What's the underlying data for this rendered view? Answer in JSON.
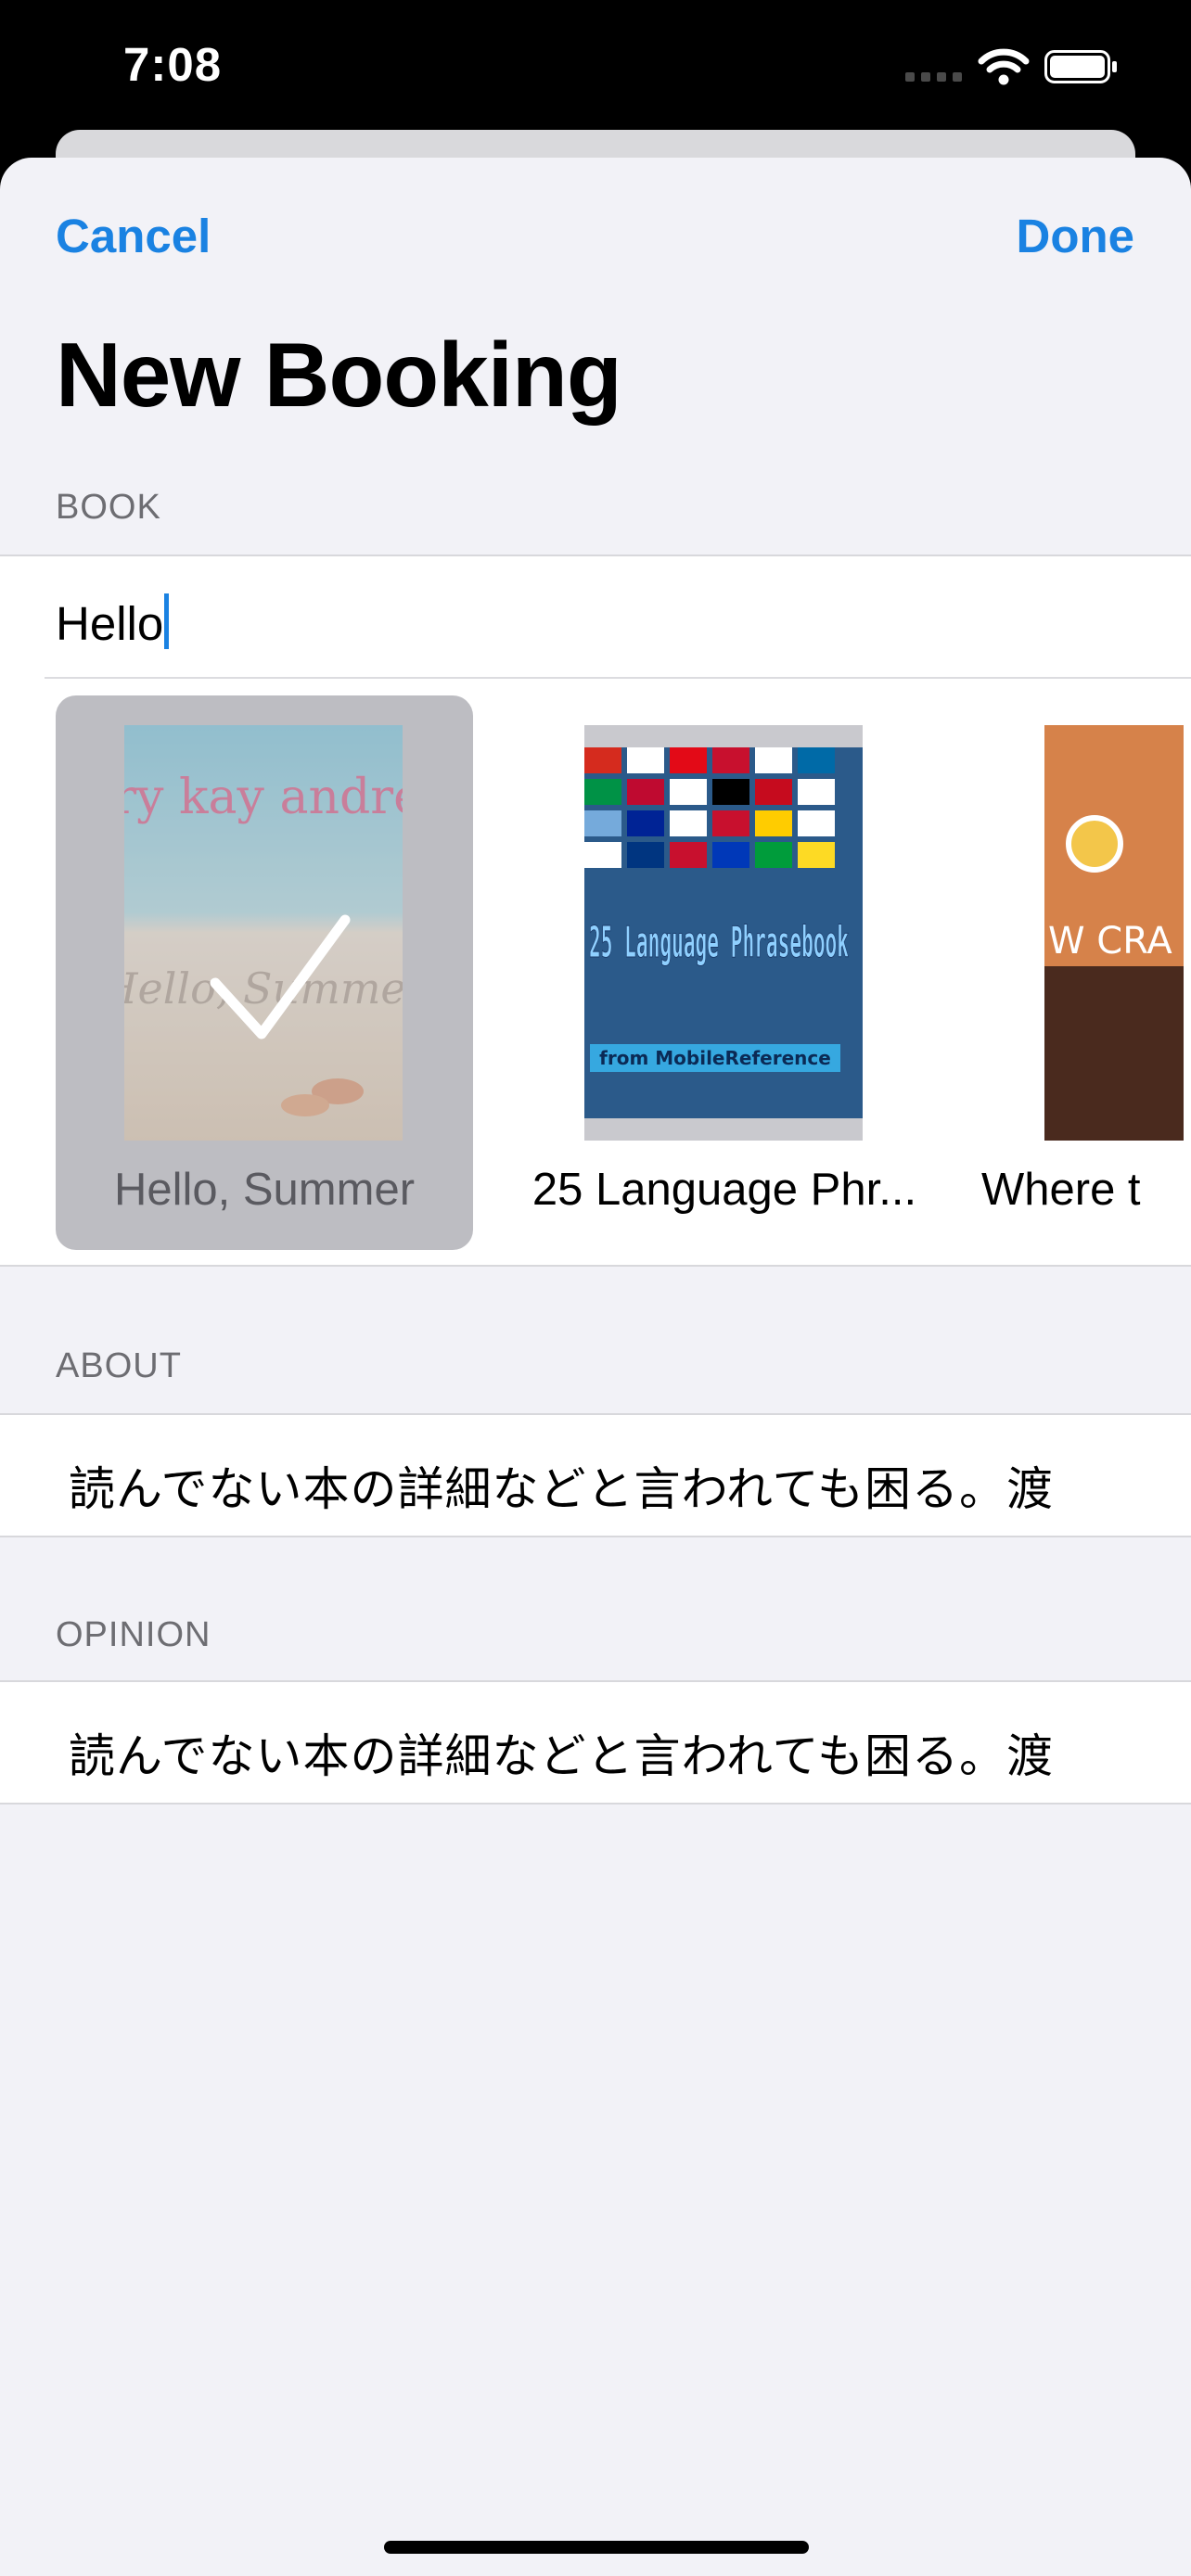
{
  "status": {
    "time": "7:08"
  },
  "nav": {
    "cancel_label": "Cancel",
    "done_label": "Done",
    "title": "New Booking"
  },
  "book_section": {
    "header": "BOOK",
    "search_value": "Hello",
    "books": [
      {
        "title": "Hello, Summer",
        "selected": true,
        "cover_author": "mary kay andrews",
        "cover_title": "Hello, Summer"
      },
      {
        "title": "25 Language Phr...",
        "selected": false,
        "cover_title": "25 Language Phrasebook",
        "cover_subtitle": "from MobileReference"
      },
      {
        "title": "Where t",
        "selected": false,
        "cover_letters": "W CRA DEL"
      }
    ]
  },
  "about_section": {
    "header": "ABOUT",
    "text": "読んでない本の詳細などと言われても困る。渡"
  },
  "opinion_section": {
    "header": "OPINION",
    "text": "読んでない本の詳細などと言われても困る。渡"
  },
  "colors": {
    "accent": "#1a82e2",
    "background": "#f2f2f7",
    "selected_tile": "#bdbdc2"
  }
}
